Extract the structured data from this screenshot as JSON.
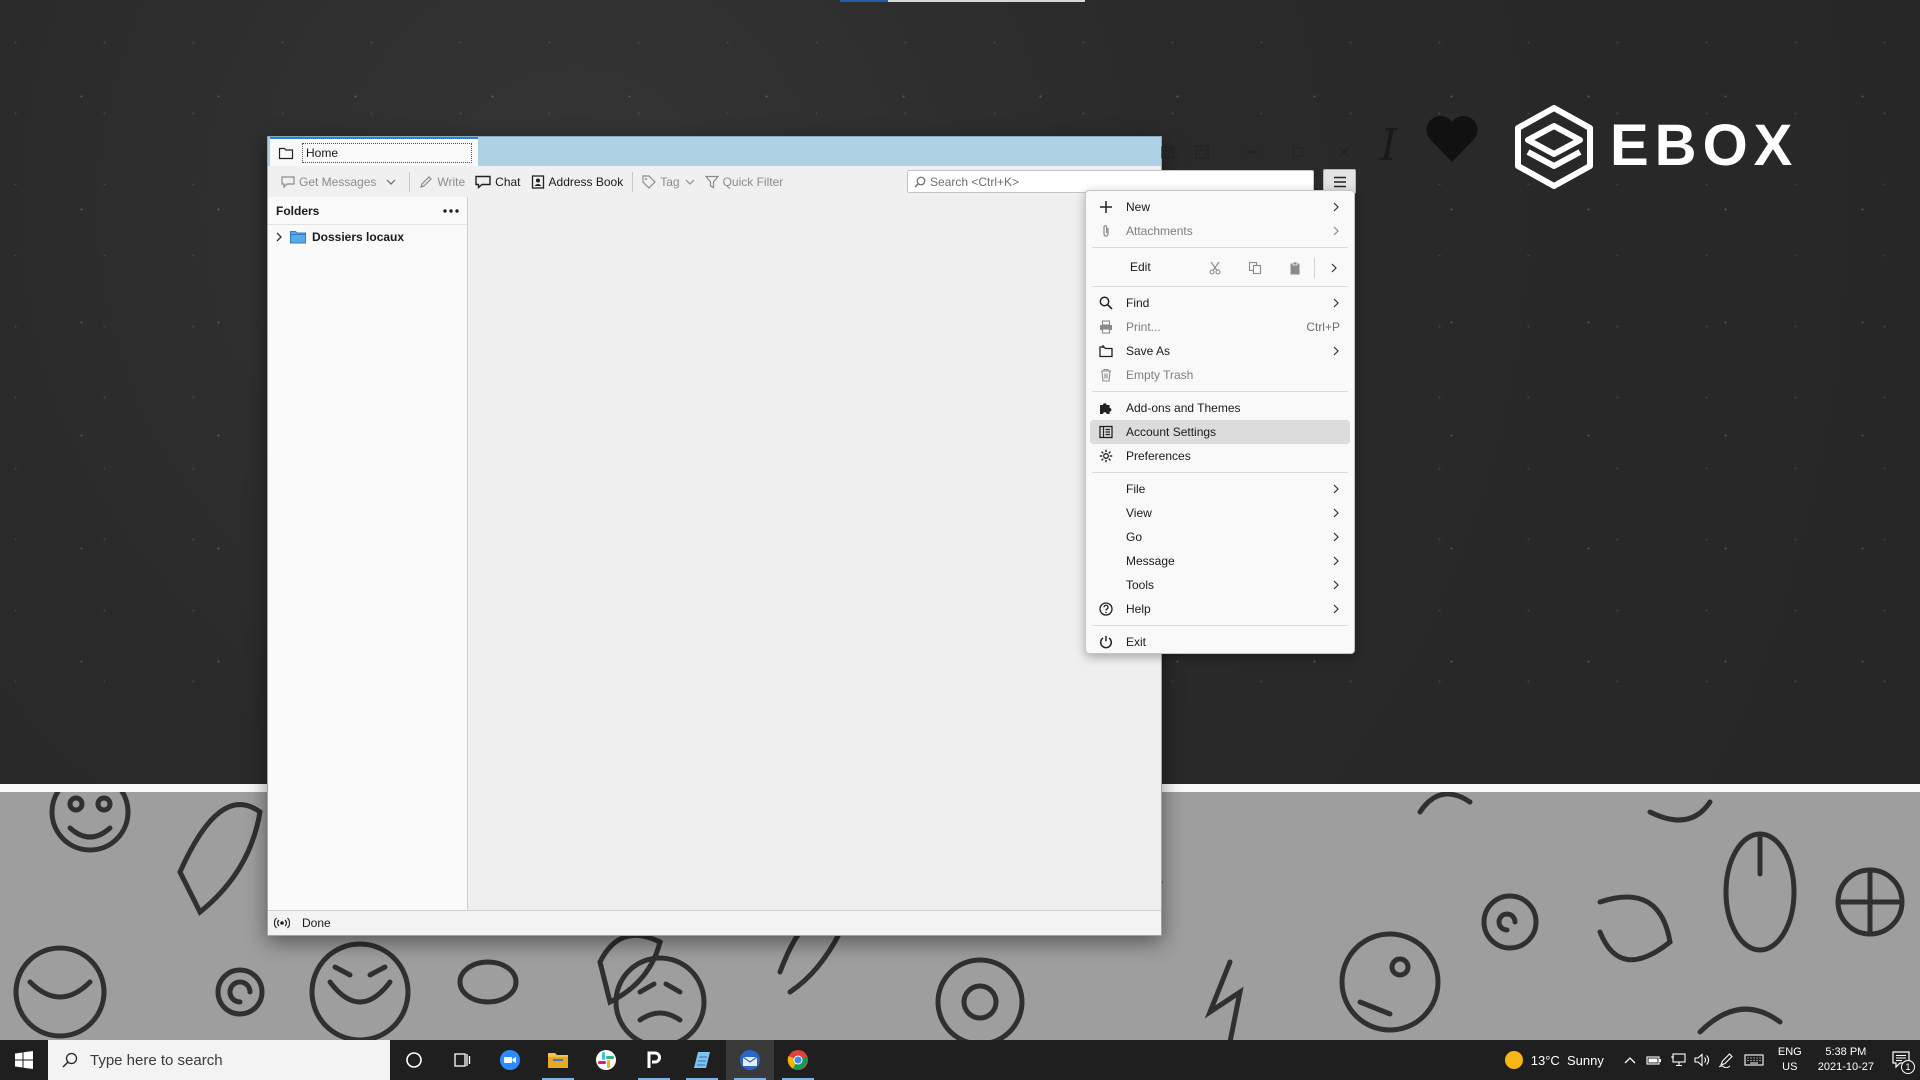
{
  "window": {
    "tab_label": "Home"
  },
  "toolbar": {
    "get_messages_label": "Get Messages",
    "write_label": "Write",
    "chat_label": "Chat",
    "address_book_label": "Address Book",
    "tag_label": "Tag",
    "quick_filter_label": "Quick Filter",
    "search_placeholder": "Search <Ctrl+K>"
  },
  "folder_pane": {
    "header": "Folders",
    "folders": [
      {
        "name": "Dossiers locaux",
        "icon": "folder-icon",
        "expanded": false
      }
    ]
  },
  "status_bar": {
    "status_text": "Done"
  },
  "app_menu": {
    "new_label": "New",
    "attachments_label": "Attachments",
    "edit_label": "Edit",
    "find_label": "Find",
    "print_label": "Print...",
    "print_shortcut": "Ctrl+P",
    "save_as_label": "Save As",
    "empty_trash_label": "Empty Trash",
    "addons_label": "Add-ons and Themes",
    "account_settings_label": "Account Settings",
    "preferences_label": "Preferences",
    "file_label": "File",
    "view_label": "View",
    "go_label": "Go",
    "message_label": "Message",
    "tools_label": "Tools",
    "help_label": "Help",
    "exit_label": "Exit",
    "highlighted_item": "Account Settings"
  },
  "desktop": {
    "brand_text": "EBOX",
    "brand_prefix": "I"
  },
  "taskbar": {
    "search_placeholder": "Type here to search",
    "apps": [
      "cortana-icon",
      "task-view-icon",
      "zoom-icon",
      "file-explorer-icon",
      "slack-icon",
      "p-app-icon",
      "notepad-icon",
      "thunderbird-icon",
      "chrome-icon"
    ],
    "weather": "13°C  Sunny",
    "lang_top": "ENG",
    "lang_bottom": "US",
    "time": "5:38 PM",
    "date": "2021-10-27",
    "notification_count": "1"
  },
  "colors": {
    "titlebar": "#aed2e4",
    "accent": "#2f7fd1",
    "menu_highlight": "#dcdcdc",
    "taskbar": "#1f1f1f"
  }
}
